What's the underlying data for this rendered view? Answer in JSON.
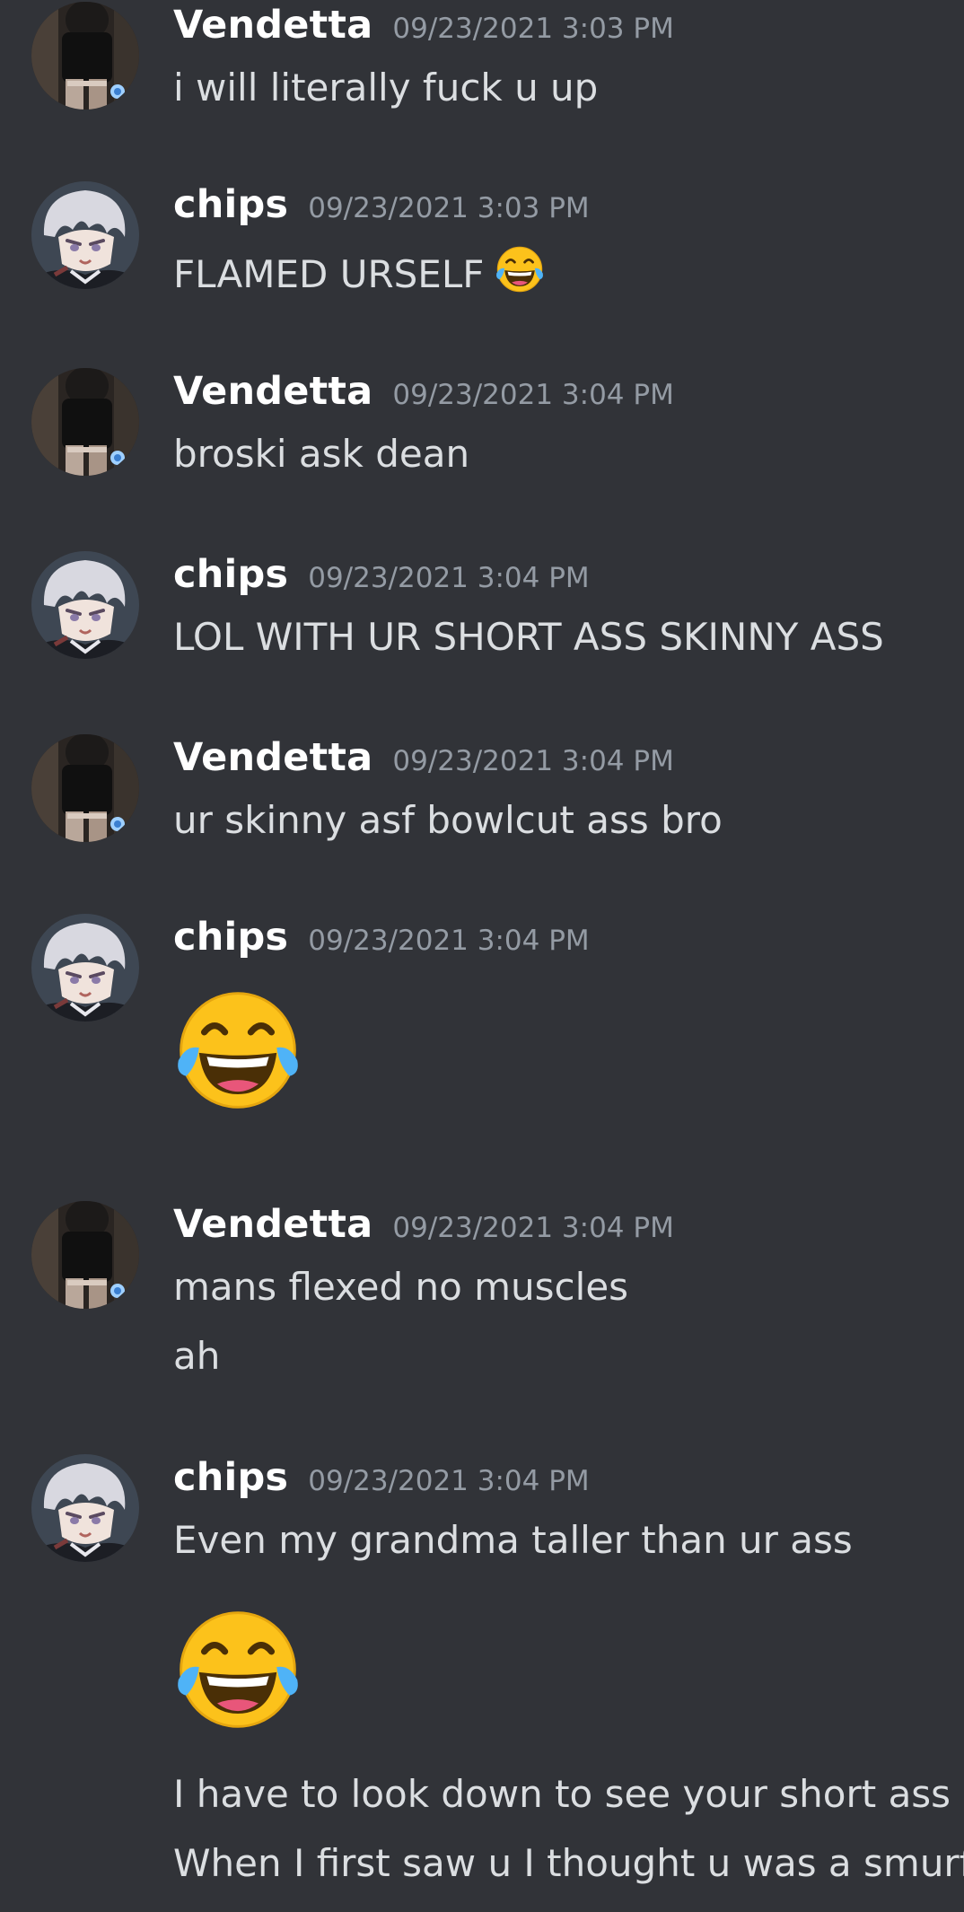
{
  "messages": [
    {
      "author": "Vendetta",
      "avatar": "vendetta-avatar",
      "timestamp": "09/23/2021 3:03 PM",
      "lines": [
        "i will literally fuck u up"
      ]
    },
    {
      "author": "chips",
      "avatar": "chips-avatar",
      "timestamp": "09/23/2021 3:03 PM",
      "lines": [
        "FLAMED URSELF"
      ],
      "inline_emoji": "face-with-tears-of-joy"
    },
    {
      "author": "Vendetta",
      "avatar": "vendetta-avatar",
      "timestamp": "09/23/2021 3:04 PM",
      "lines": [
        "broski ask dean"
      ]
    },
    {
      "author": "chips",
      "avatar": "chips-avatar",
      "timestamp": "09/23/2021 3:04 PM",
      "lines": [
        "LOL WITH UR SHORT ASS SKINNY ASS"
      ]
    },
    {
      "author": "Vendetta",
      "avatar": "vendetta-avatar",
      "timestamp": "09/23/2021 3:04 PM",
      "lines": [
        "ur skinny asf bowlcut ass bro"
      ]
    },
    {
      "author": "chips",
      "avatar": "chips-avatar",
      "timestamp": "09/23/2021 3:04 PM",
      "lines": [],
      "big_emoji": "face-with-tears-of-joy"
    },
    {
      "author": "Vendetta",
      "avatar": "vendetta-avatar",
      "timestamp": "09/23/2021 3:04 PM",
      "lines": [
        "mans flexed no muscles",
        "ah"
      ]
    },
    {
      "author": "chips",
      "avatar": "chips-avatar",
      "timestamp": "09/23/2021 3:04 PM",
      "lines": [
        "Even my grandma taller than ur ass"
      ],
      "big_emoji": "face-with-tears-of-joy",
      "after_lines": [
        "I have to look down to see your short ass",
        "When I first saw u I thought u was a smurf"
      ]
    }
  ],
  "colors": {
    "background": "#313338",
    "username": "#ffffff",
    "timestamp": "#949ba4",
    "message_text": "#dbdee1"
  }
}
